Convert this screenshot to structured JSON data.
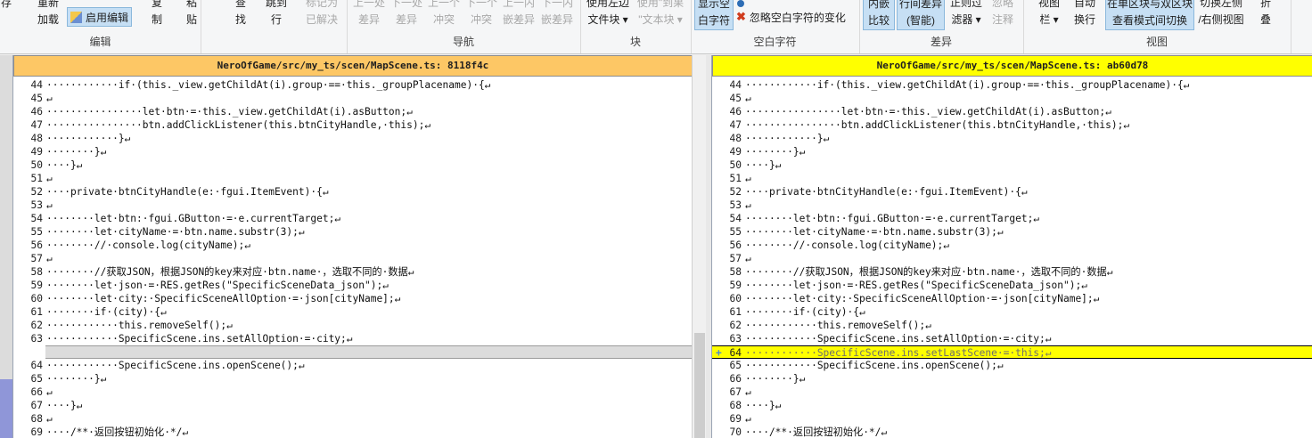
{
  "ribbon": {
    "items": [
      {
        "id": "cut-top",
        "text": "存"
      },
      {
        "id": "reload",
        "text": "重新\n加载"
      },
      {
        "id": "copy",
        "text": "复\n制"
      },
      {
        "id": "paste",
        "text": "粘\n贴"
      },
      {
        "id": "find",
        "text": "查\n找"
      },
      {
        "id": "goto",
        "text": "跳到\n行"
      },
      {
        "id": "mark-resolved",
        "text": "标记为\n已解决"
      },
      {
        "id": "prev-diff",
        "text": "上一处\n差异"
      },
      {
        "id": "next-diff",
        "text": "下一处\n差异"
      },
      {
        "id": "prev-conflict",
        "text": "上一个\n冲突"
      },
      {
        "id": "next-conflict",
        "text": "下一个\n冲突"
      },
      {
        "id": "prev-inline",
        "text": "上一内\n嵌差异"
      },
      {
        "id": "next-inline",
        "text": "下一内\n嵌差异"
      },
      {
        "id": "use-left-block",
        "text": "使用左边\n文件块 ▾"
      },
      {
        "id": "use-text-block",
        "text": "使用\"到果\n\"文本块 ▾"
      },
      {
        "id": "show-whitespace",
        "text": "显示空\n白字符"
      },
      {
        "id": "inline-compare",
        "text": "内嵌\n比较"
      },
      {
        "id": "line-diff",
        "text": "行间差异\n(智能)"
      },
      {
        "id": "filter",
        "text": "正则过\n滤器 ▾"
      },
      {
        "id": "ignore-comments",
        "text": "忽略\n注释"
      },
      {
        "id": "view-bar",
        "text": "视图\n栏 ▾"
      },
      {
        "id": "auto-wrap",
        "text": "自动\n换行"
      },
      {
        "id": "toggle-single",
        "text": "在单区块与双区块\n查看模式间切换"
      },
      {
        "id": "toggle-left-right",
        "text": "切换左侧\n/右侧视图"
      },
      {
        "id": "fold",
        "text": "折\n叠"
      }
    ],
    "enable_edit": "启用编辑",
    "ignore_whitespace_change": "忽略空白字符的变化",
    "groups": {
      "edit": "编辑",
      "navigation": "导航",
      "block": "块",
      "whitespace": "空白字符",
      "diff": "差异",
      "view": "视图"
    }
  },
  "left": {
    "title": "NeroOfGame/src/my_ts/scen/MapScene.ts: 8118f4c",
    "lines": [
      {
        "n": "44",
        "t": "············if·(this._view.getChildAt(i).group·==·this._groupPlacename)·{↵"
      },
      {
        "n": "45",
        "t": "↵"
      },
      {
        "n": "46",
        "t": "················let·btn·=·this._view.getChildAt(i).asButton;↵"
      },
      {
        "n": "47",
        "t": "················btn.addClickListener(this.btnCityHandle,·this);↵"
      },
      {
        "n": "48",
        "t": "············}↵"
      },
      {
        "n": "49",
        "t": "········}↵"
      },
      {
        "n": "50",
        "t": "····}↵"
      },
      {
        "n": "51",
        "t": "↵"
      },
      {
        "n": "52",
        "t": "····private·btnCityHandle(e:·fgui.ItemEvent)·{↵"
      },
      {
        "n": "53",
        "t": "↵"
      },
      {
        "n": "54",
        "t": "········let·btn:·fgui.GButton·=·e.currentTarget;↵"
      },
      {
        "n": "55",
        "t": "········let·cityName·=·btn.name.substr(3);↵"
      },
      {
        "n": "56",
        "t": "········//·console.log(cityName);↵"
      },
      {
        "n": "57",
        "t": "↵"
      },
      {
        "n": "58",
        "t": "········//获取JSON，根据JSON的key来对应·btn.name·，选取不同的·数据↵"
      },
      {
        "n": "59",
        "t": "········let·json·=·RES.getRes(\"SpecificSceneData_json\");↵"
      },
      {
        "n": "60",
        "t": "········let·city:·SpecificSceneAllOption·=·json[cityName];↵"
      },
      {
        "n": "61",
        "t": "········if·(city)·{↵"
      },
      {
        "n": "62",
        "t": "············this.removeSelf();↵"
      },
      {
        "n": "63",
        "t": "············SpecificScene.ins.setAllOption·=·city;↵"
      },
      {
        "n": "",
        "t": ""
      },
      {
        "n": "64",
        "t": "············SpecificScene.ins.openScene();↵"
      },
      {
        "n": "65",
        "t": "········}↵"
      },
      {
        "n": "66",
        "t": "↵"
      },
      {
        "n": "67",
        "t": "····}↵"
      },
      {
        "n": "68",
        "t": "↵"
      },
      {
        "n": "69",
        "t": "····/**·返回按钮初始化·*/↵"
      }
    ]
  },
  "right": {
    "title": "NeroOfGame/src/my_ts/scen/MapScene.ts: ab60d78",
    "lines": [
      {
        "n": "44",
        "t": "············if·(this._view.getChildAt(i).group·==·this._groupPlacename)·{↵"
      },
      {
        "n": "45",
        "t": "↵"
      },
      {
        "n": "46",
        "t": "················let·btn·=·this._view.getChildAt(i).asButton;↵"
      },
      {
        "n": "47",
        "t": "················btn.addClickListener(this.btnCityHandle,·this);↵"
      },
      {
        "n": "48",
        "t": "············}↵"
      },
      {
        "n": "49",
        "t": "········}↵"
      },
      {
        "n": "50",
        "t": "····}↵"
      },
      {
        "n": "51",
        "t": "↵"
      },
      {
        "n": "52",
        "t": "····private·btnCityHandle(e:·fgui.ItemEvent)·{↵"
      },
      {
        "n": "53",
        "t": "↵"
      },
      {
        "n": "54",
        "t": "········let·btn:·fgui.GButton·=·e.currentTarget;↵"
      },
      {
        "n": "55",
        "t": "········let·cityName·=·btn.name.substr(3);↵"
      },
      {
        "n": "56",
        "t": "········//·console.log(cityName);↵"
      },
      {
        "n": "57",
        "t": "↵"
      },
      {
        "n": "58",
        "t": "········//获取JSON，根据JSON的key来对应·btn.name·，选取不同的·数据↵"
      },
      {
        "n": "59",
        "t": "········let·json·=·RES.getRes(\"SpecificSceneData_json\");↵"
      },
      {
        "n": "60",
        "t": "········let·city:·SpecificSceneAllOption·=·json[cityName];↵"
      },
      {
        "n": "61",
        "t": "········if·(city)·{↵"
      },
      {
        "n": "62",
        "t": "············this.removeSelf();↵"
      },
      {
        "n": "63",
        "t": "············SpecificScene.ins.setAllOption·=·city;↵"
      },
      {
        "n": "64",
        "t": "············SpecificScene.ins.setLastScene·=·this;↵",
        "changed": true
      },
      {
        "n": "65",
        "t": "············SpecificScene.ins.openScene();↵"
      },
      {
        "n": "66",
        "t": "········}↵"
      },
      {
        "n": "67",
        "t": "↵"
      },
      {
        "n": "68",
        "t": "····}↵"
      },
      {
        "n": "69",
        "t": "↵"
      },
      {
        "n": "70",
        "t": "····/**·返回按钮初始化·*/↵"
      }
    ]
  },
  "change_marker": "+",
  "colors": {
    "left_header": "#fdc765",
    "right_header": "#ffff00",
    "changed_line": "#ffff00",
    "selected_button": "#c6dff4"
  }
}
